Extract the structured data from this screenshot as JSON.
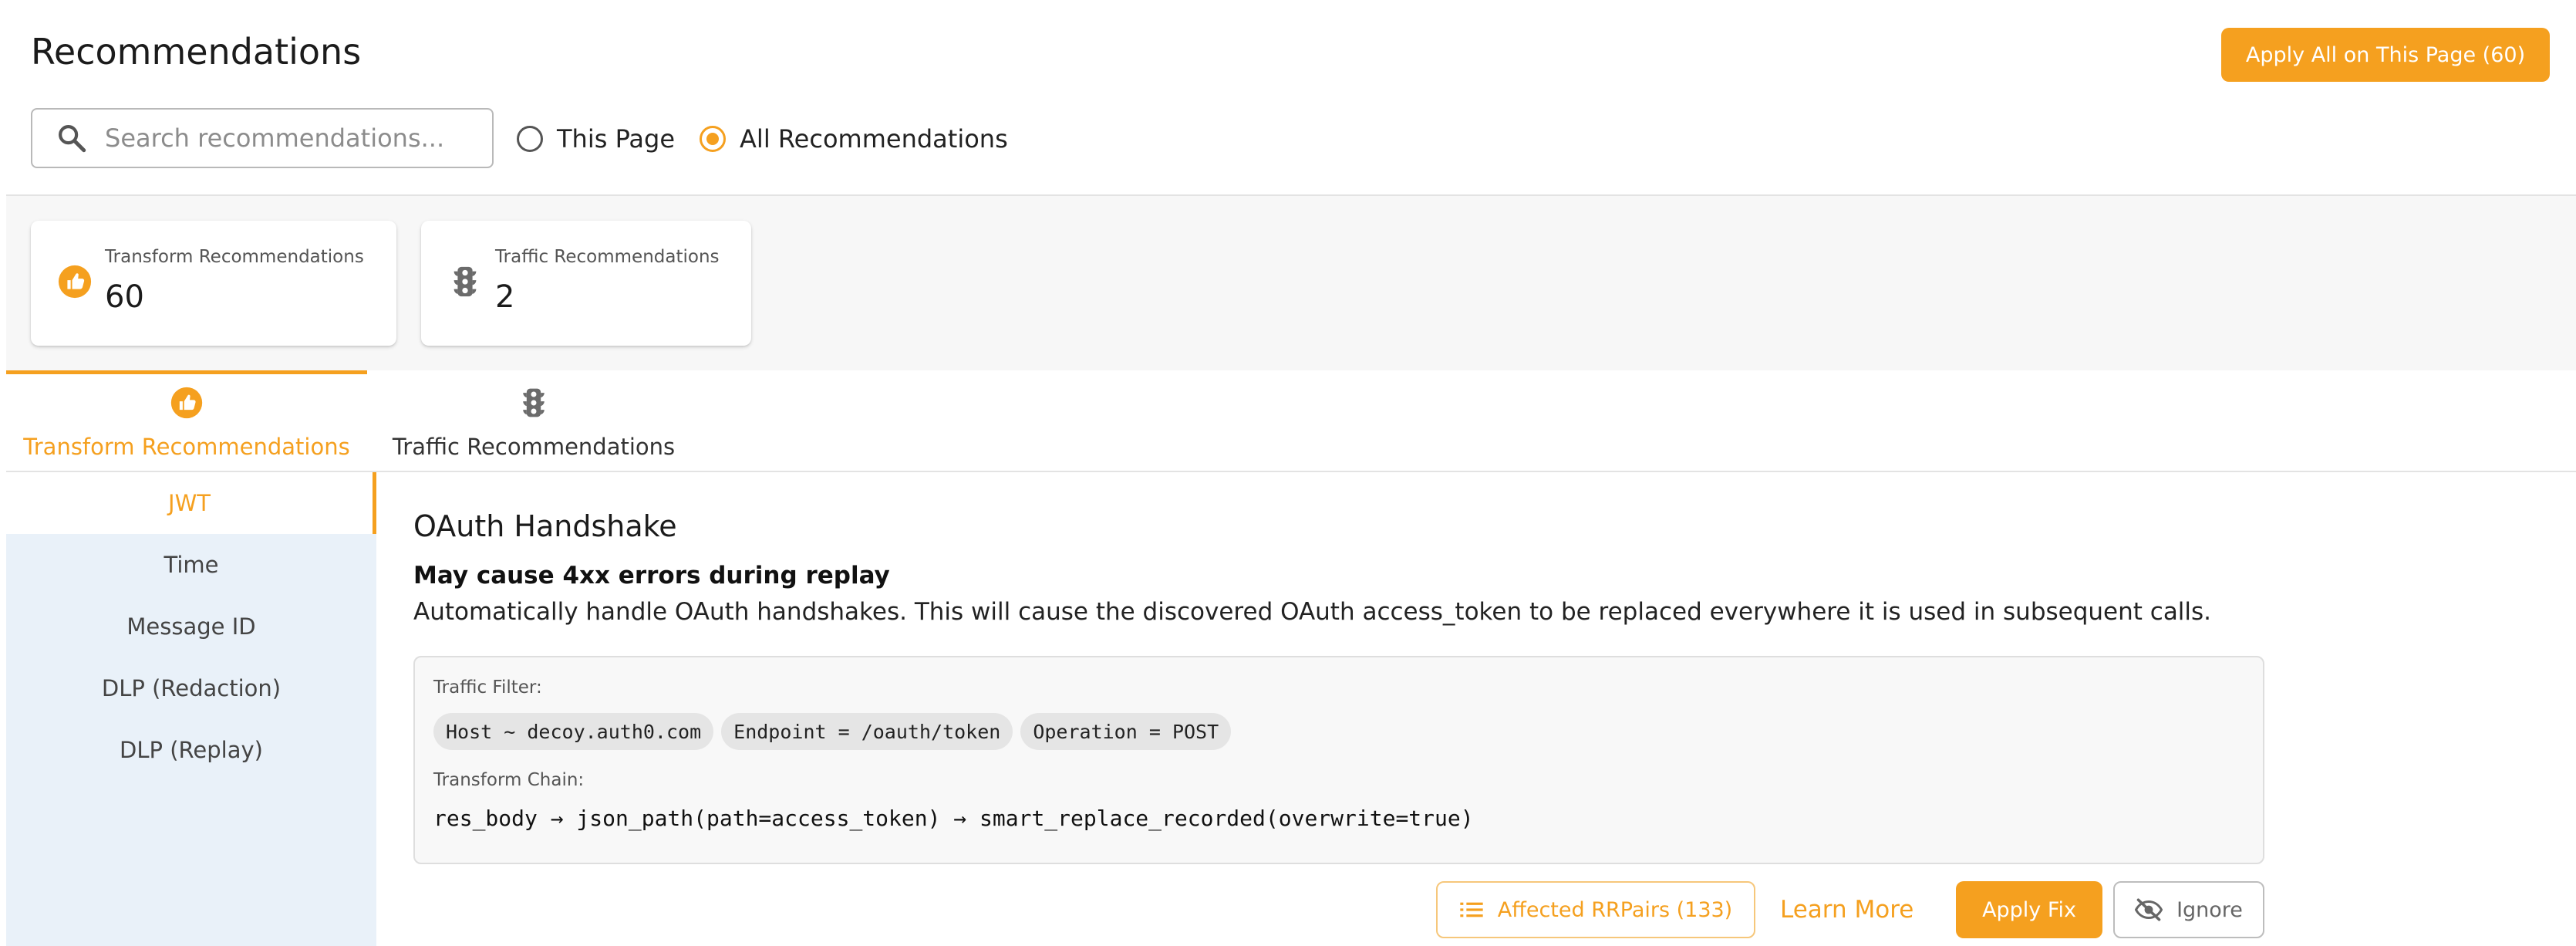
{
  "header": {
    "title": "Recommendations",
    "apply_all_label": "Apply All on This Page (60)"
  },
  "search": {
    "placeholder": "Search recommendations...",
    "value": ""
  },
  "scope": {
    "options": [
      {
        "label": "This Page",
        "selected": false
      },
      {
        "label": "All Recommendations",
        "selected": true
      }
    ]
  },
  "stats": [
    {
      "label": "Transform Recommendations",
      "value": "60",
      "icon": "thumbs-up-icon"
    },
    {
      "label": "Traffic Recommendations",
      "value": "2",
      "icon": "traffic-light-icon"
    }
  ],
  "tabs": [
    {
      "label": "Transform Recommendations",
      "icon": "thumbs-up-icon",
      "active": true
    },
    {
      "label": "Traffic Recommendations",
      "icon": "traffic-light-icon",
      "active": false
    }
  ],
  "sidebar": {
    "items": [
      {
        "label": "JWT",
        "active": true
      },
      {
        "label": "Time",
        "active": false
      },
      {
        "label": "Message ID",
        "active": false
      },
      {
        "label": "DLP (Redaction)",
        "active": false
      },
      {
        "label": "DLP (Replay)",
        "active": false
      }
    ]
  },
  "recommendation": {
    "title": "OAuth Handshake",
    "warning": "May cause 4xx errors during replay",
    "description": "Automatically handle OAuth handshakes. This will cause the discovered OAuth access_token to be replaced everywhere it is used in subsequent calls.",
    "traffic_filter_label": "Traffic Filter:",
    "filters": [
      "Host ~ decoy.auth0.com",
      "Endpoint = /oauth/token",
      "Operation = POST"
    ],
    "transform_chain_label": "Transform Chain:",
    "transform_chain": "res_body → json_path(path=access_token) → smart_replace_recorded(overwrite=true)"
  },
  "actions": {
    "affected_label": "Affected RRPairs (133)",
    "learn_more_label": "Learn More",
    "apply_fix_label": "Apply Fix",
    "ignore_label": "Ignore"
  },
  "colors": {
    "accent": "#f5a01f",
    "sidebar_bg": "#e9f1f9",
    "stats_band_bg": "#f7f7f7"
  }
}
